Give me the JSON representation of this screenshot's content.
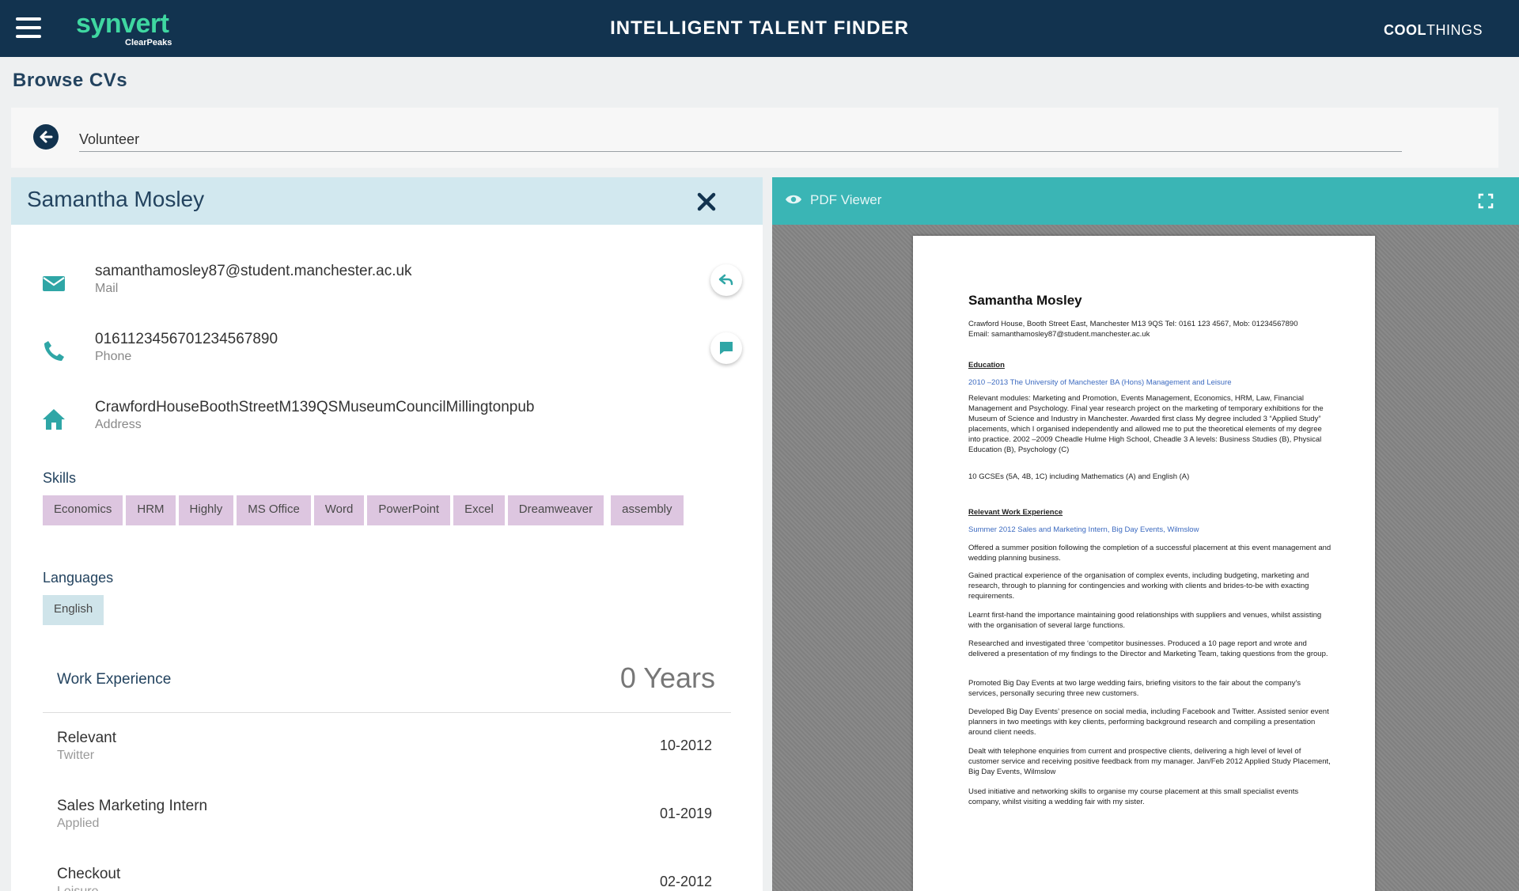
{
  "topbar": {
    "logo_main": "synvert",
    "logo_sub": "ClearPeaks",
    "title": "INTELLIGENT TALENT FINDER",
    "brand_bold": "COOL",
    "brand_light": "THINGS"
  },
  "page": {
    "title": "Browse CVs"
  },
  "search": {
    "value": "Volunteer"
  },
  "candidate": {
    "name": "Samantha Mosley",
    "email": "samanthamosley87@student.manchester.ac.uk",
    "email_label": "Mail",
    "phone": "0161123456701234567890",
    "phone_label": "Phone",
    "address": "CrawfordHouseBoothStreetM139QSMuseumCouncilMillingtonpub",
    "address_label": "Address"
  },
  "skills": {
    "heading": "Skills",
    "items": [
      "Economics",
      "HRM",
      "Highly",
      "MS Office",
      "Word",
      "PowerPoint",
      "Excel",
      "Dreamweaver",
      "assembly"
    ]
  },
  "languages": {
    "heading": "Languages",
    "items": [
      "English"
    ]
  },
  "work": {
    "heading": "Work Experience",
    "years": "0 Years",
    "items": [
      {
        "title": "Relevant",
        "sub": "Twitter",
        "date": "10-2012"
      },
      {
        "title": "Sales Marketing Intern",
        "sub": "Applied",
        "date": "01-2019"
      },
      {
        "title": "Checkout",
        "sub": "Leisure",
        "date": "02-2012"
      }
    ]
  },
  "pdf": {
    "header": "PDF Viewer",
    "name": "Samantha Mosley",
    "contact_line1": "Crawford House, Booth Street East, Manchester M13 9QS Tel: 0161 123 4567, Mob: 01234567890",
    "contact_line2": "Email: samanthamosley87@student.manchester.ac.uk",
    "education_heading": "Education",
    "education_title": "2010 –2013 The University of Manchester BA (Hons) Management and Leisure",
    "education_body": "Relevant modules: Marketing and Promotion, Events Management, Economics, HRM, Law, Financial Management and Psychology. Final year research project on the marketing of temporary exhibitions for the Museum of Science and Industry in Manchester. Awarded first class My degree included 3 “Applied Study” placements, which I organised independently and allowed me to put the theoretical elements of my degree into practice.   2002 –2009 Cheadle Hulme High School, Cheadle 3 A levels: Business Studies (B), Physical Education (B), Psychology (C)",
    "gcse": "10 GCSEs (5A, 4B, 1C) including Mathematics (A) and English (A)",
    "work_heading": "Relevant Work Experience",
    "work_title": "Summer 2012 Sales and Marketing Intern, Big Day Events, Wilmslow",
    "paragraphs": [
      "Offered a summer position following the completion of a successful placement at this event management and wedding planning business.",
      "Gained practical experience of the organisation of complex events, including budgeting, marketing and research, through to planning for contingencies and working with clients and brides-to-be with exacting requirements.",
      "Learnt first-hand the importance maintaining good relationships with suppliers and venues, whilst assisting with the organisation of several large functions.",
      "Researched and investigated three ‘competitor businesses. Produced a 10 page report and wrote and delivered a presentation of my findings to the Director and Marketing Team, taking questions from the group.",
      "Promoted Big Day Events at two large wedding fairs, briefing visitors to the fair about the company's services, personally securing three new customers.",
      "Developed Big Day Events’ presence on social media, including Facebook and Twitter. Assisted senior event planners in two meetings with key clients, performing background research and compiling a presentation around client needs.",
      "Dealt with telephone enquiries from current and prospective clients, delivering a high level of level of customer service and receiving positive feedback from my manager.   Jan/Feb 2012 Applied Study Placement, Big Day Events, Wilmslow",
      "Used initiative and networking skills to organise my course placement at this small specialist events company, whilst visiting a wedding fair with my sister."
    ]
  },
  "colors": {
    "topbar": "#12334f",
    "accent_green": "#3fd7a1",
    "teal": "#3ab5b5",
    "skill_chip": "#ddc6e0",
    "language_chip": "#cfe4ea"
  }
}
